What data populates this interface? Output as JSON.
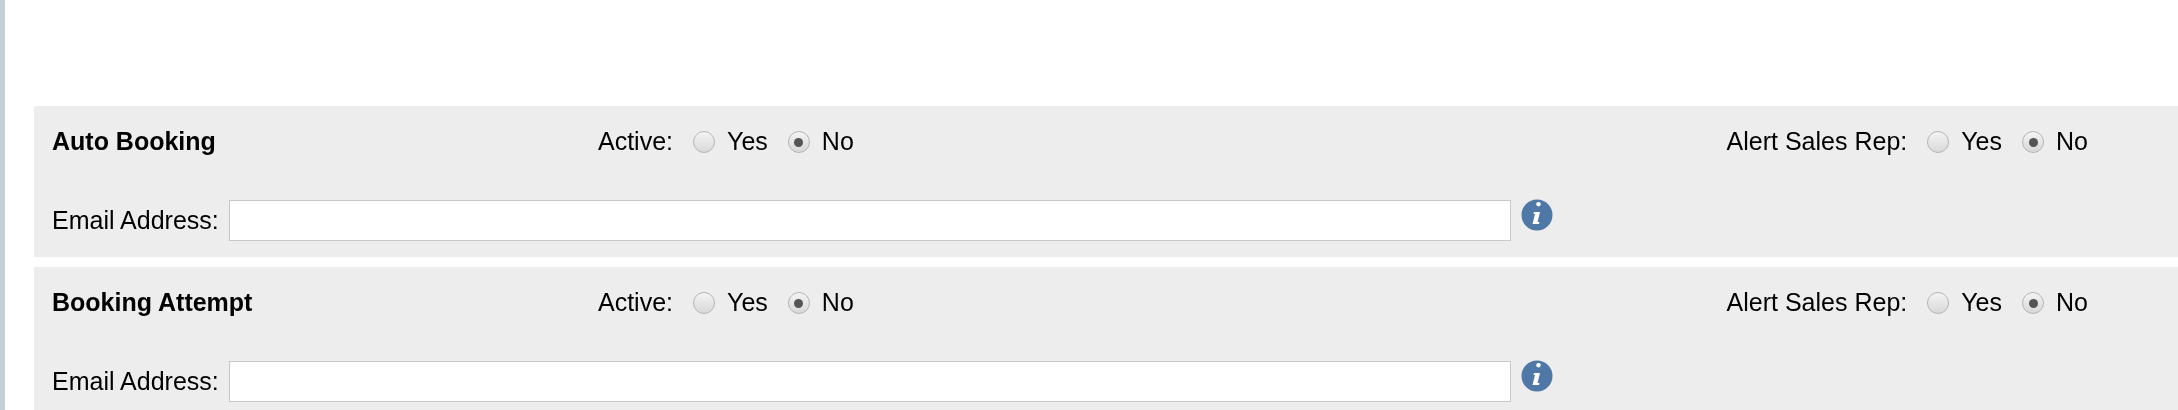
{
  "sections": [
    {
      "title": "Auto Booking",
      "active": {
        "label": "Active:",
        "options": [
          {
            "label": "Yes",
            "selected": false
          },
          {
            "label": "No",
            "selected": true
          }
        ]
      },
      "alert": {
        "label": "Alert Sales Rep:",
        "options": [
          {
            "label": "Yes",
            "selected": false
          },
          {
            "label": "No",
            "selected": true
          }
        ]
      },
      "email": {
        "label": "Email Address:"
      }
    },
    {
      "title": "Booking Attempt",
      "active": {
        "label": "Active:",
        "options": [
          {
            "label": "Yes",
            "selected": false
          },
          {
            "label": "No",
            "selected": true
          }
        ]
      },
      "alert": {
        "label": "Alert Sales Rep:",
        "options": [
          {
            "label": "Yes",
            "selected": false
          },
          {
            "label": "No",
            "selected": true
          }
        ]
      },
      "email": {
        "label": "Email Address:"
      }
    }
  ]
}
